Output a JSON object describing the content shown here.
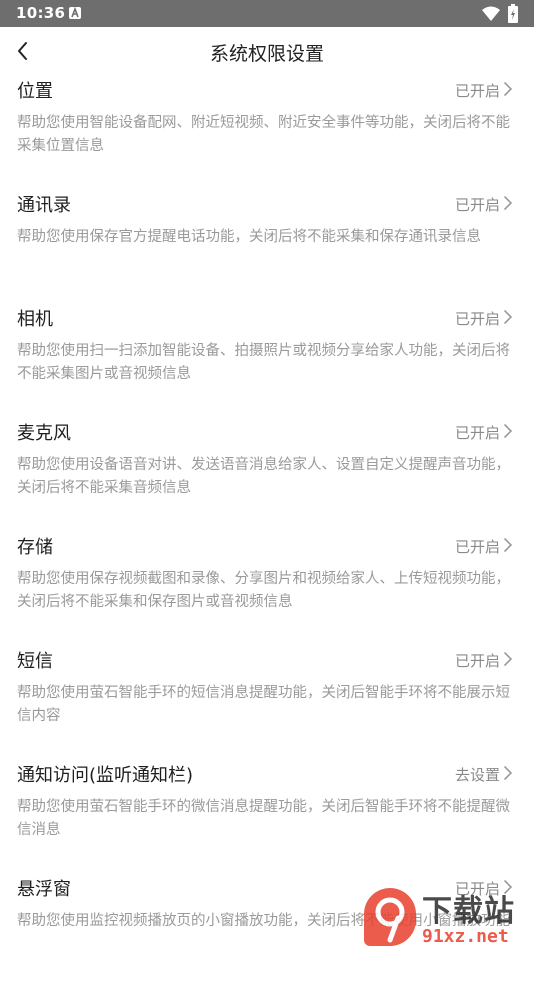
{
  "status_bar": {
    "time": "10:36",
    "app_icon": "a-notification-icon",
    "wifi_icon": "wifi-icon",
    "battery_icon": "battery-charging-icon"
  },
  "header": {
    "title": "系统权限设置",
    "back_icon": "chevron-left-icon"
  },
  "permissions": [
    {
      "title": "位置",
      "status": "已开启",
      "description": "帮助您使用智能设备配网、附近短视频、附近安全事件等功能，关闭后将不能采集位置信息"
    },
    {
      "title": "通讯录",
      "status": "已开启",
      "description": "帮助您使用保存官方提醒电话功能，关闭后将不能采集和保存通讯录信息"
    },
    {
      "title": "相机",
      "status": "已开启",
      "description": "帮助您使用扫一扫添加智能设备、拍摄照片或视频分享给家人功能，关闭后将不能采集图片或音视频信息"
    },
    {
      "title": "麦克风",
      "status": "已开启",
      "description": "帮助您使用设备语音对讲、发送语音消息给家人、设置自定义提醒声音功能，关闭后将不能采集音频信息"
    },
    {
      "title": "存储",
      "status": "已开启",
      "description": "帮助您使用保存视频截图和录像、分享图片和视频给家人、上传短视频功能，关闭后将不能采集和保存图片或音视频信息"
    },
    {
      "title": "短信",
      "status": "已开启",
      "description": "帮助您使用萤石智能手环的短信消息提醒功能，关闭后智能手环将不能展示短信内容"
    },
    {
      "title": "通知访问(监听通知栏)",
      "status": "去设置",
      "description": "帮助您使用萤石智能手环的微信消息提醒功能，关闭后智能手环将不能提醒微信消息"
    },
    {
      "title": "悬浮窗",
      "status": "已开启",
      "description": "帮助您使用监控视频播放页的小窗播放功能，关闭后将不能使用小窗播放功能"
    }
  ],
  "watermark": {
    "top_text": "下载站",
    "bottom_text": "91xz.net"
  },
  "colors": {
    "status_bar_bg": "#6e6e6e",
    "title_text": "#222222",
    "description_text": "#9a9a9a",
    "status_text": "#8a8a8a",
    "watermark_red": "#e8402f"
  }
}
